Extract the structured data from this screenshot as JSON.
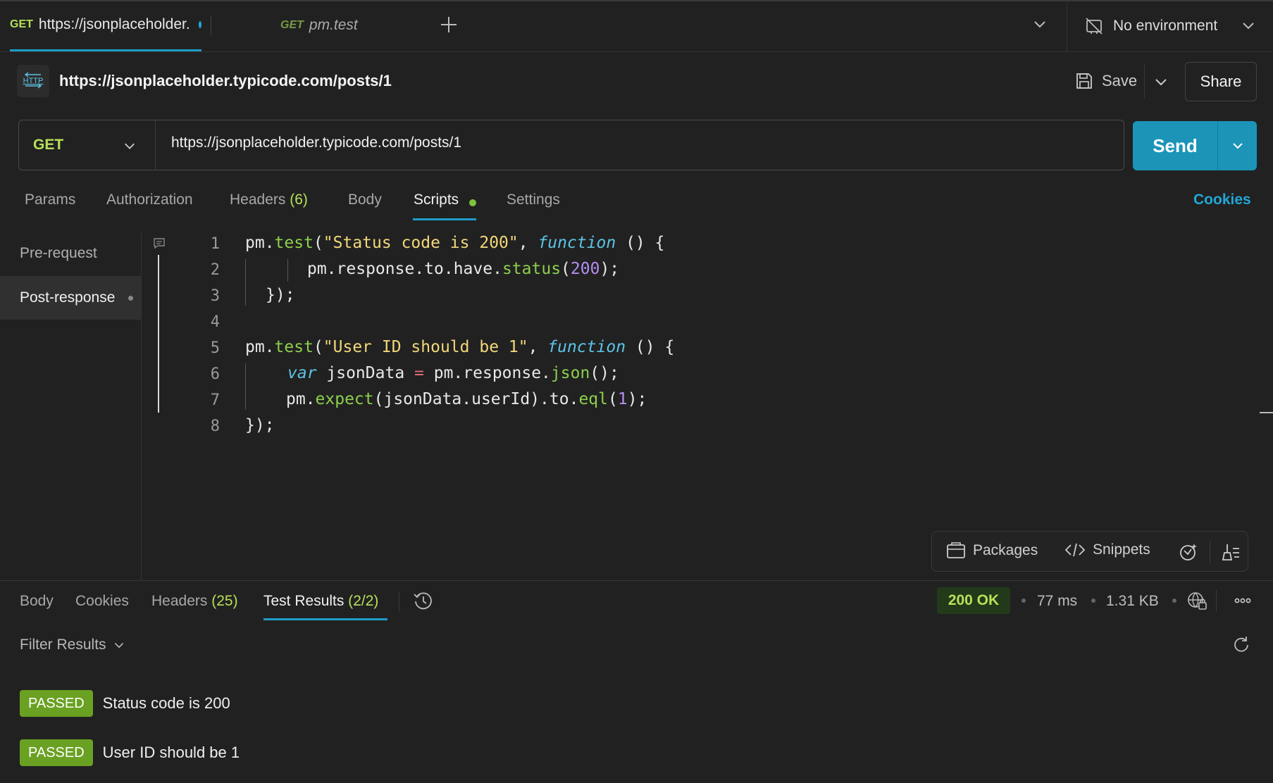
{
  "tabs": [
    {
      "method": "GET",
      "title": "https://jsonplaceholder."
    },
    {
      "method": "GET",
      "title": "pm.test"
    }
  ],
  "environment": {
    "label": "No environment"
  },
  "request": {
    "title": "https://jsonplaceholder.typicode.com/posts/1",
    "badge": "HTTP",
    "method": "GET",
    "url": "https://jsonplaceholder.typicode.com/posts/1",
    "save_label": "Save",
    "share_label": "Share",
    "send_label": "Send"
  },
  "request_tabs": {
    "params": "Params",
    "authorization": "Authorization",
    "headers": "Headers",
    "headers_count": "(6)",
    "body": "Body",
    "scripts": "Scripts",
    "settings": "Settings",
    "cookies": "Cookies"
  },
  "scripts_sidebar": {
    "pre_request": "Pre-request",
    "post_response": "Post-response"
  },
  "editor": {
    "line_numbers": [
      "1",
      "2",
      "3",
      "4",
      "5",
      "6",
      "7",
      "8"
    ],
    "code": {
      "l1_obj": "pm.",
      "l1_fn": "test",
      "l1_open": "(",
      "l1_str": "\"Status code is 200\"",
      "l1_comma": ", ",
      "l1_kw": "function",
      "l1_end": " () {",
      "l2_pre": "pm.response.to.have.",
      "l2_fn": "status",
      "l2_open": "(",
      "l2_num": "200",
      "l2_end": ");",
      "l3": "});",
      "l5_obj": "pm.",
      "l5_fn": "test",
      "l5_open": "(",
      "l5_str": "\"User ID should be 1\"",
      "l5_comma": ", ",
      "l5_kw": "function",
      "l5_end": " () {",
      "l6_kw": "var",
      "l6_var": " jsonData ",
      "l6_op": "=",
      "l6_mid": " pm.response.",
      "l6_fn": "json",
      "l6_end": "();",
      "l7_obj": "pm.",
      "l7_fn": "expect",
      "l7_mid": "(jsonData.userId).to.",
      "l7_fn2": "eql",
      "l7_open": "(",
      "l7_num": "1",
      "l7_end": ");",
      "l8": "});"
    }
  },
  "editor_toolbar": {
    "packages": "Packages",
    "snippets": "Snippets"
  },
  "response_tabs": {
    "body": "Body",
    "cookies": "Cookies",
    "headers": "Headers",
    "headers_count": "(25)",
    "test_results": "Test Results",
    "test_results_count": "(2/2)"
  },
  "response_meta": {
    "status": "200 OK",
    "time": "77 ms",
    "size": "1.31 KB"
  },
  "filter": {
    "label": "Filter Results"
  },
  "test_results": [
    {
      "status": "PASSED",
      "name": "Status code is 200"
    },
    {
      "status": "PASSED",
      "name": "User ID should be 1"
    }
  ],
  "colors": {
    "accent": "#1b94b8",
    "method_get": "#b7e05a",
    "passed": "#6aa122",
    "tab_indicator": "#1d9cc6"
  }
}
